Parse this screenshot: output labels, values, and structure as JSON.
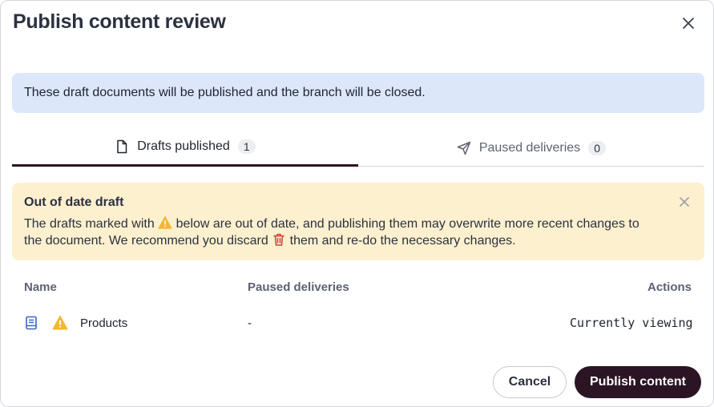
{
  "dialog": {
    "title": "Publish content review",
    "close_icon": "close-icon"
  },
  "info_banner": {
    "text": "These draft documents will be published and the branch will be closed."
  },
  "tabs": [
    {
      "label": "Drafts published",
      "count": "1",
      "icon": "document-icon",
      "selected": true
    },
    {
      "label": "Paused deliveries",
      "count": "0",
      "icon": "send-icon",
      "selected": false
    }
  ],
  "warning": {
    "title": "Out of date draft",
    "text_part1": "The drafts marked with",
    "text_part2": "below are out of date, and publishing them may overwrite more recent changes to the document. We recommend you discard",
    "text_part3": "them and re-do the necessary changes.",
    "warning_icon": "warning-icon",
    "trash_icon": "trash-icon",
    "colors": {
      "background": "#fcf0cf",
      "warning": "#f5b731",
      "trash": "#d93b3b"
    }
  },
  "table": {
    "headers": {
      "name": "Name",
      "paused": "Paused deliveries",
      "actions": "Actions"
    },
    "rows": [
      {
        "name": "Products",
        "paused": "-",
        "action": "Currently viewing",
        "type_icon": "book-icon",
        "status_icon": "warning-icon"
      }
    ]
  },
  "footer": {
    "cancel_label": "Cancel",
    "publish_label": "Publish content"
  },
  "colors": {
    "accent": "#2b1424",
    "info_background": "#dde7fa"
  }
}
